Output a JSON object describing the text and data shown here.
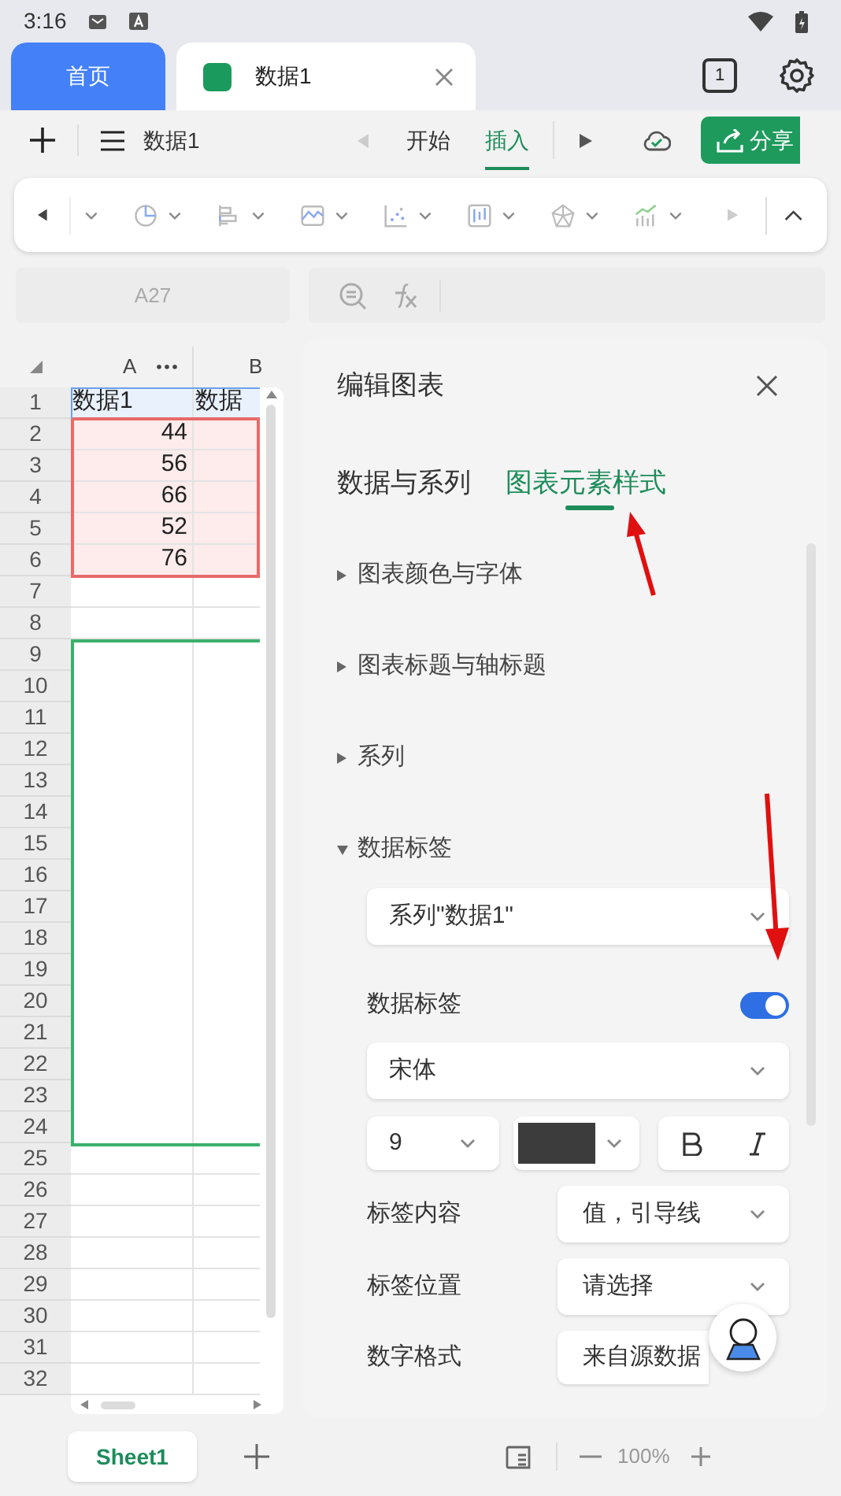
{
  "status_bar": {
    "time": "3:16"
  },
  "tabs": [
    {
      "label": "首页",
      "kind": "home",
      "selected": false
    },
    {
      "label": "数据1",
      "kind": "doc",
      "selected": true
    }
  ],
  "tab_count": "1",
  "toolbar": {
    "file_name": "数据1",
    "menu_tabs": [
      {
        "label": "开始",
        "selected": false
      },
      {
        "label": "插入",
        "selected": true
      }
    ],
    "share": "分享"
  },
  "formula_bar": {
    "cell_ref": "A27"
  },
  "sheet": {
    "columns": [
      "A",
      "B"
    ],
    "rows": [
      {
        "number": "1",
        "kind": "series_name",
        "cells": [
          "数据1",
          "数据"
        ]
      },
      {
        "number": "2",
        "kind": "value",
        "cells": [
          "44",
          ""
        ]
      },
      {
        "number": "3",
        "kind": "value",
        "cells": [
          "56",
          ""
        ]
      },
      {
        "number": "4",
        "kind": "value",
        "cells": [
          "66",
          ""
        ]
      },
      {
        "number": "5",
        "kind": "value",
        "cells": [
          "52",
          ""
        ]
      },
      {
        "number": "6",
        "kind": "value",
        "cells": [
          "76",
          ""
        ]
      },
      {
        "number": "7",
        "kind": "plain",
        "cells": [
          "",
          ""
        ]
      },
      {
        "number": "8",
        "kind": "plain",
        "cells": [
          "",
          ""
        ]
      },
      {
        "number": "9",
        "kind": "chart",
        "cells": []
      },
      {
        "number": "10",
        "kind": "chart",
        "cells": []
      },
      {
        "number": "11",
        "kind": "chart",
        "cells": []
      },
      {
        "number": "12",
        "kind": "chart",
        "cells": []
      },
      {
        "number": "13",
        "kind": "chart",
        "cells": []
      },
      {
        "number": "14",
        "kind": "chart",
        "cells": []
      },
      {
        "number": "15",
        "kind": "chart",
        "cells": []
      },
      {
        "number": "16",
        "kind": "chart",
        "cells": []
      },
      {
        "number": "17",
        "kind": "chart",
        "cells": []
      },
      {
        "number": "18",
        "kind": "chart",
        "cells": []
      },
      {
        "number": "19",
        "kind": "chart",
        "cells": []
      },
      {
        "number": "20",
        "kind": "chart",
        "cells": []
      },
      {
        "number": "21",
        "kind": "chart",
        "cells": []
      },
      {
        "number": "22",
        "kind": "chart",
        "cells": []
      },
      {
        "number": "23",
        "kind": "chart",
        "cells": []
      },
      {
        "number": "24",
        "kind": "chart",
        "cells": []
      },
      {
        "number": "25",
        "kind": "plain",
        "cells": [
          "",
          ""
        ]
      },
      {
        "number": "26",
        "kind": "plain",
        "cells": [
          "",
          ""
        ]
      },
      {
        "number": "27",
        "kind": "plain",
        "cells": [
          "",
          ""
        ]
      },
      {
        "number": "28",
        "kind": "plain",
        "cells": [
          "",
          ""
        ]
      },
      {
        "number": "29",
        "kind": "plain",
        "cells": [
          "",
          ""
        ]
      },
      {
        "number": "30",
        "kind": "plain",
        "cells": [
          "",
          ""
        ]
      },
      {
        "number": "31",
        "kind": "plain",
        "cells": [
          "",
          ""
        ]
      },
      {
        "number": "32",
        "kind": "plain",
        "cells": [
          "",
          ""
        ]
      }
    ]
  },
  "panel": {
    "title": "编辑图表",
    "tabs": [
      {
        "label": "数据与系列",
        "selected": false
      },
      {
        "label": "图表元素样式",
        "selected": true
      }
    ],
    "sections": [
      {
        "label": "图表颜色与字体",
        "expanded": false
      },
      {
        "label": "图表标题与轴标题",
        "expanded": false
      },
      {
        "label": "系列",
        "expanded": false
      },
      {
        "label": "数据标签",
        "expanded": true
      }
    ],
    "series_select": {
      "value": "系列\"数据1\""
    },
    "data_labels": {
      "label": "数据标签",
      "on": true
    },
    "font": {
      "value": "宋体"
    },
    "font_size": {
      "value": "9"
    },
    "font_color": {
      "color": "#3c3c3c"
    },
    "fields": [
      {
        "label": "标签内容",
        "value": "值，引导线"
      },
      {
        "label": "标签位置",
        "value": "请选择"
      },
      {
        "label": "数字格式",
        "value": "来自源数据"
      }
    ]
  },
  "sheet_tabs": [
    {
      "label": "Sheet1",
      "selected": true
    }
  ],
  "zoom": {
    "value": "100%"
  }
}
